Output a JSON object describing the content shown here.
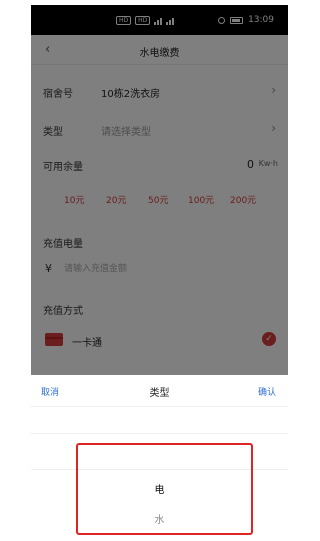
{
  "status_bar": {
    "sim1": "HD",
    "sim2": "HD",
    "time": "13:09"
  },
  "nav": {
    "back_icon": "chevron-left-icon",
    "title": "水电缴费"
  },
  "form": {
    "dorm": {
      "label": "宿舍号",
      "value": "10栋2洗衣房"
    },
    "type": {
      "label": "类型",
      "placeholder": "请选择类型"
    },
    "balance": {
      "label": "可用余量",
      "value": "0",
      "unit": "Kw·h"
    },
    "amount_options": [
      "10元",
      "20元",
      "50元",
      "100元",
      "200元"
    ],
    "recharge": {
      "label": "充值电量",
      "currency": "¥",
      "placeholder": "请输入充值金额"
    },
    "payment": {
      "label": "充值方式",
      "method": "一卡通",
      "icon": "card-icon",
      "check_icon": "check-icon"
    }
  },
  "picker": {
    "cancel": "取消",
    "title": "类型",
    "confirm": "确认",
    "options": [
      "电",
      "水"
    ],
    "selected": "电"
  },
  "colors": {
    "accent_red": "#d63c3c",
    "link_blue": "#2e6fd1",
    "highlight_red": "#e02424"
  }
}
